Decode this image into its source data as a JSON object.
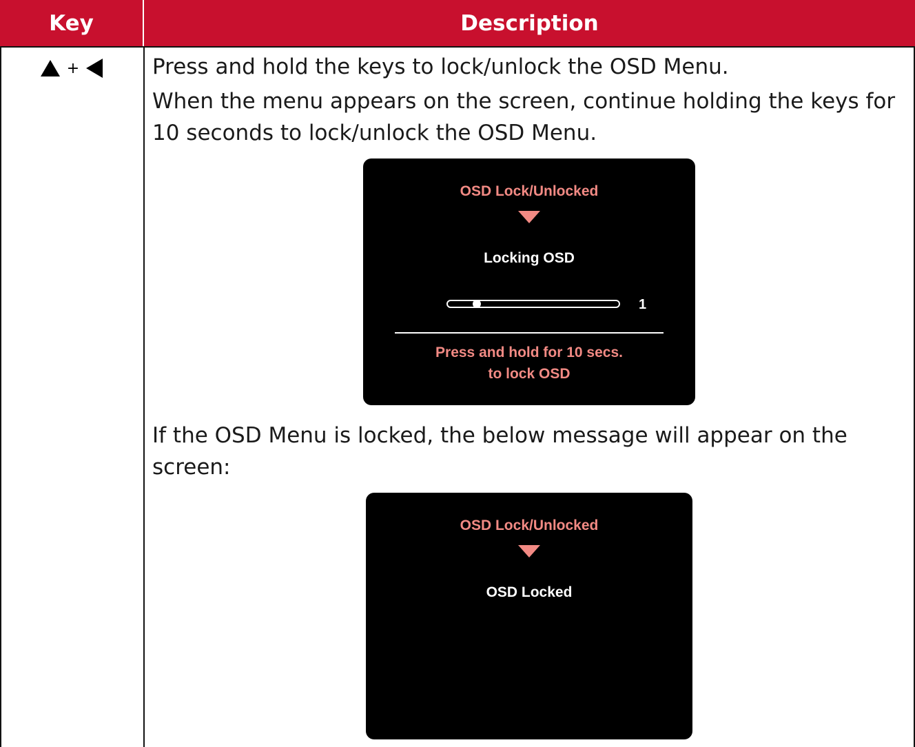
{
  "table": {
    "headers": {
      "key": "Key",
      "description": "Description"
    },
    "row": {
      "key_symbol": {
        "left_icon": "triangle-up-icon",
        "plus": "+",
        "right_icon": "triangle-left-icon"
      },
      "paragraphs": [
        "Press and hold the keys to lock/unlock the OSD Menu.",
        "When the menu appears on the screen, continue holding the keys for 10 seconds to lock/unlock the OSD Menu.",
        "If the OSD Menu is locked, the below message will appear on the screen:"
      ]
    }
  },
  "osd_locking": {
    "title": "OSD Lock/Unlocked",
    "message": "Locking OSD",
    "progress_value": "1",
    "progress_fraction": 0.1,
    "hint_line1": "Press and hold for 10 secs.",
    "hint_line2": "to lock OSD"
  },
  "osd_locked": {
    "title": "OSD Lock/Unlocked",
    "message": "OSD Locked"
  },
  "colors": {
    "header_bg": "#c8102e",
    "osd_bg": "#000000",
    "osd_accent": "#f28a84",
    "osd_text": "#ffffff"
  }
}
